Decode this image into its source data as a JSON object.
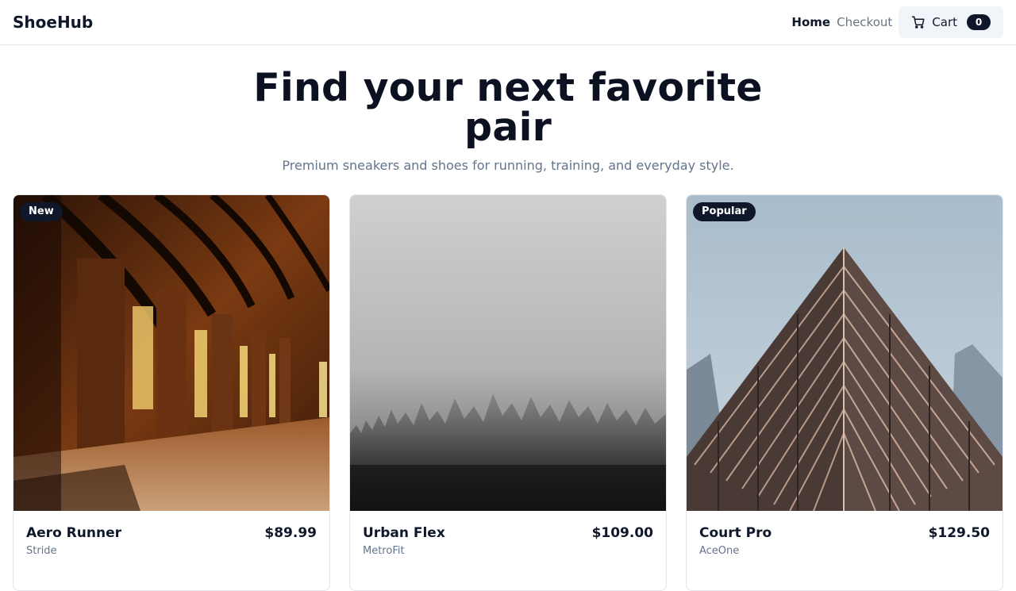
{
  "header": {
    "brand": "ShoeHub",
    "nav": {
      "home_label": "Home",
      "checkout_label": "Checkout"
    },
    "cart": {
      "icon": "shopping-cart-icon",
      "label": "Cart",
      "count": "0"
    }
  },
  "hero": {
    "title": "Find your next favorite pair",
    "subtitle": "Premium sneakers and shoes for running, training, and everyday style."
  },
  "products": [
    {
      "name": "Aero Runner",
      "price": "$89.99",
      "brand": "Stride",
      "badge": "New",
      "image": "cloister-arches-photo"
    },
    {
      "name": "Urban Flex",
      "price": "$109.00",
      "brand": "MetroFit",
      "badge": "",
      "image": "foggy-forest-photo"
    },
    {
      "name": "Court Pro",
      "price": "$129.50",
      "brand": "AceOne",
      "badge": "Popular",
      "image": "skyscraper-photo"
    }
  ],
  "colors": {
    "primary": "#0f172a",
    "muted_text": "#64748b",
    "border": "#e5e7eb",
    "cart_bg": "#f1f5f9"
  }
}
